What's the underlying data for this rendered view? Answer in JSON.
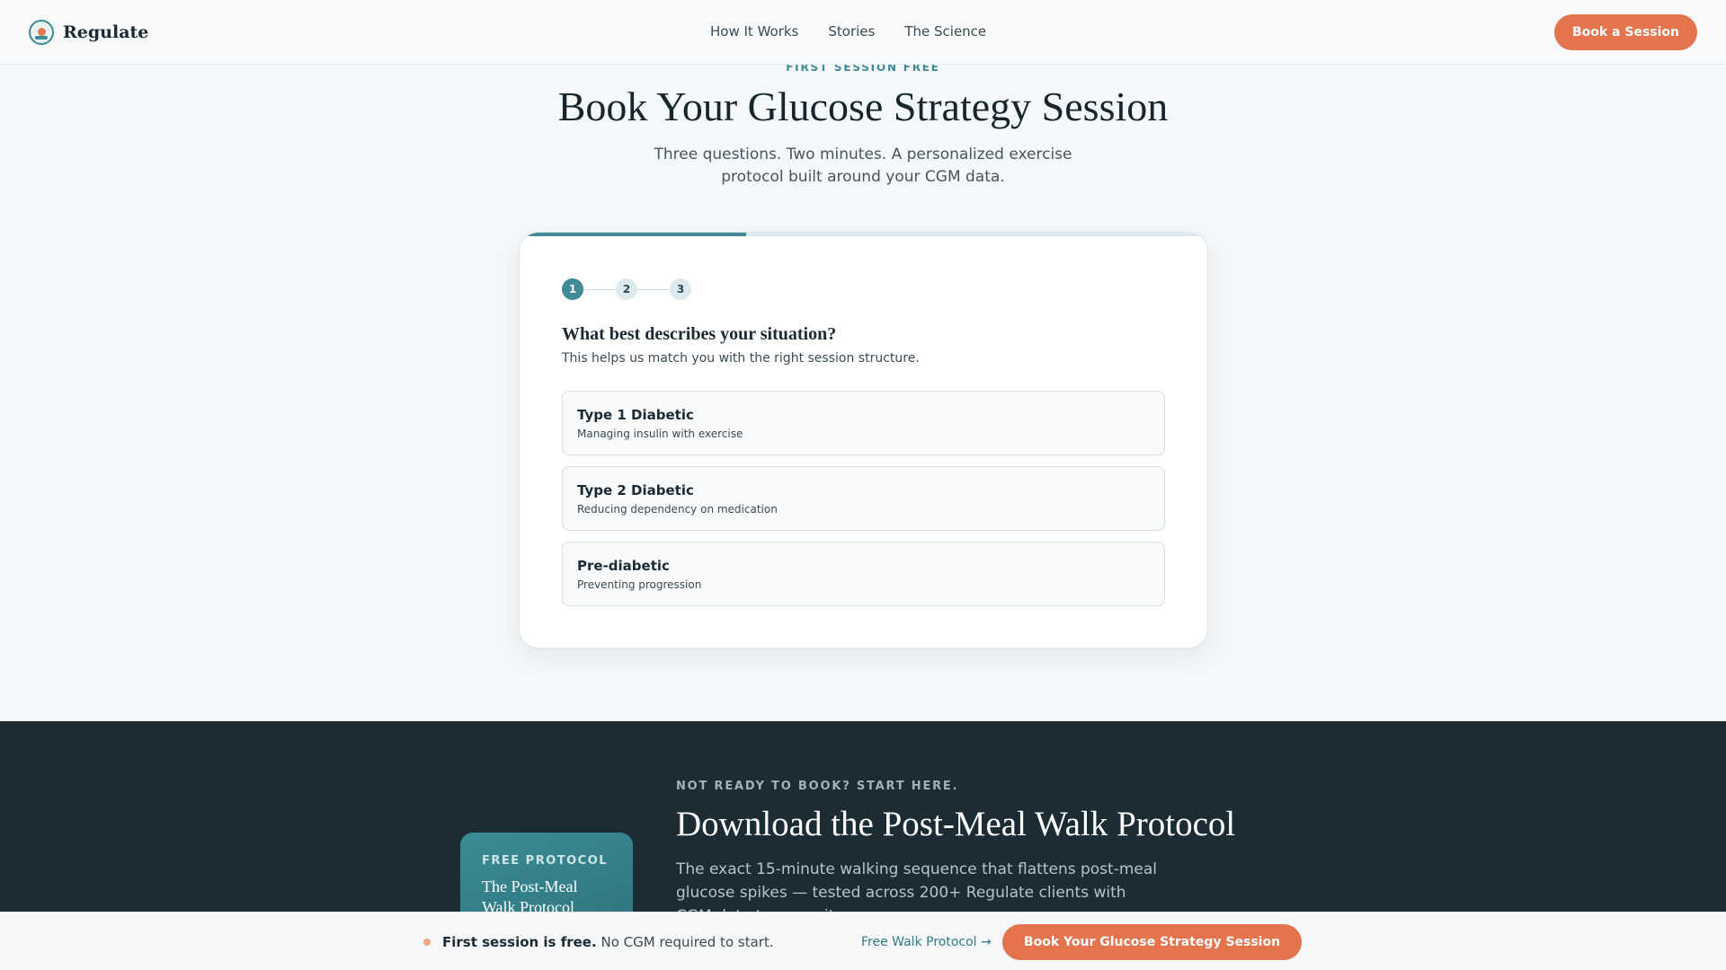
{
  "brand": {
    "name": "Regulate"
  },
  "nav": {
    "links": [
      "How It Works",
      "Stories",
      "The Science"
    ],
    "cta": "Book a Session"
  },
  "hero": {
    "eyebrow": "FIRST SESSION FREE",
    "title": "Book Your Glucose Strategy Session",
    "subtitle": "Three questions. Two minutes. A personalized exercise protocol built around your CGM data."
  },
  "wizard": {
    "progress_fraction": 0.33,
    "steps": [
      "1",
      "2",
      "3"
    ],
    "active_step": 1,
    "question": "What best describes your situation?",
    "help": "This helps us match you with the right session structure.",
    "options": [
      {
        "title": "Type 1 Diabetic",
        "subtitle": "Managing insulin with exercise"
      },
      {
        "title": "Type 2 Diabetic",
        "subtitle": "Reducing dependency on medication"
      },
      {
        "title": "Pre-diabetic",
        "subtitle": "Preventing progression"
      }
    ]
  },
  "lead_magnet": {
    "card_eyebrow": "FREE PROTOCOL",
    "card_title": "The Post-Meal Walk Protocol",
    "eyebrow": "NOT READY TO BOOK? START HERE.",
    "title": "Download the Post-Meal Walk Protocol",
    "body": "The exact 15-minute walking sequence that flattens post-meal glucose spikes — tested across 200+ Regulate clients with CGM data to prove it."
  },
  "sticky_bar": {
    "bold": "First session is free.",
    "text": "No CGM required to start.",
    "link": "Free Walk Protocol →",
    "cta": "Book Your Glucose Strategy Session"
  },
  "colors": {
    "accent": "#e4744e",
    "teal": "#3f8a94",
    "dark_bg": "#1b2c34"
  }
}
